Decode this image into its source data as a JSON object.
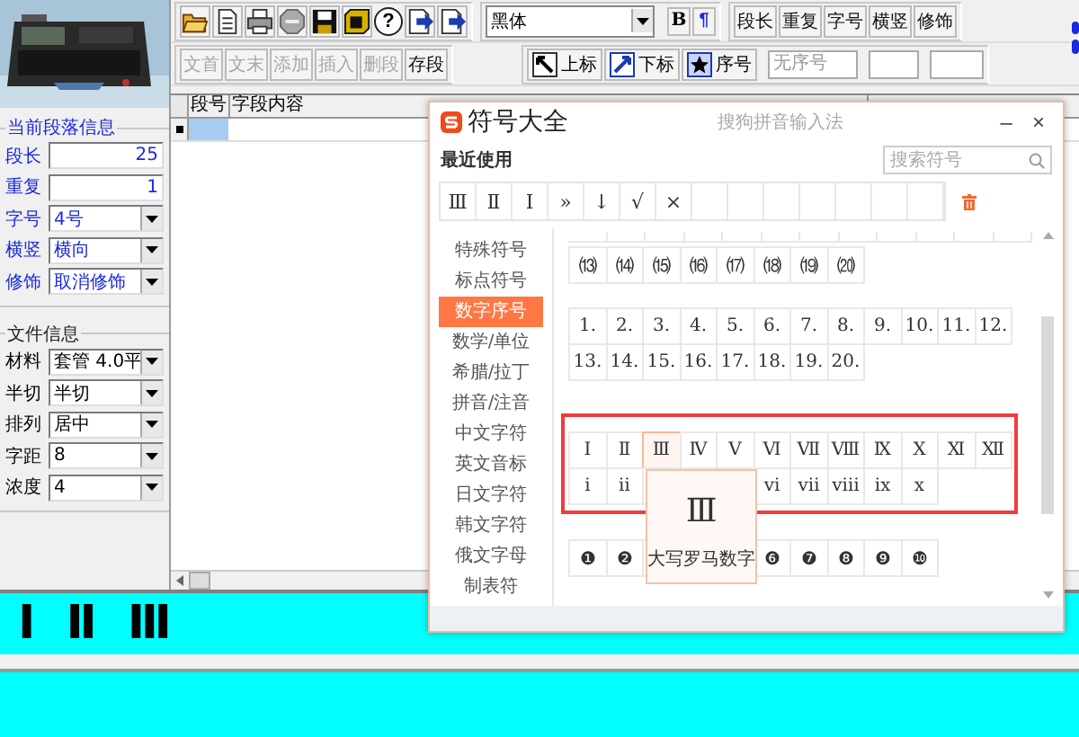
{
  "device_picture": {
    "kind": "picture"
  },
  "paragraph_info": {
    "title": "当前段落信息",
    "fields": [
      {
        "label": "段长",
        "kind": "number",
        "value": "25"
      },
      {
        "label": "重复",
        "kind": "number",
        "value": "1"
      },
      {
        "label": "字号",
        "kind": "select",
        "value": "4号"
      },
      {
        "label": "横竖",
        "kind": "select",
        "value": "横向"
      },
      {
        "label": "修饰",
        "kind": "select",
        "value": "取消修饰"
      }
    ]
  },
  "file_info": {
    "title": "文件信息",
    "fields": [
      {
        "label": "材料",
        "kind": "select",
        "value": "套管 4.0平"
      },
      {
        "label": "半切",
        "kind": "select",
        "value": "半切"
      },
      {
        "label": "排列",
        "kind": "select",
        "value": "居中"
      },
      {
        "label": "字距",
        "kind": "select",
        "value": "8"
      },
      {
        "label": "浓度",
        "kind": "select",
        "value": "4"
      }
    ]
  },
  "toolbar": {
    "icon_buttons": [
      {
        "kind": "folder"
      },
      {
        "kind": "document"
      },
      {
        "kind": "printer"
      },
      {
        "kind": "stop"
      },
      {
        "kind": "floppy"
      },
      {
        "kind": "disk"
      },
      {
        "kind": "help",
        "label": "?"
      },
      {
        "kind": "page-arrow"
      },
      {
        "kind": "page-arrow"
      }
    ],
    "font": "黑体",
    "format_buttons": [
      {
        "kind": "bold",
        "label": "B"
      },
      {
        "kind": "paragraph",
        "label": "¶"
      }
    ],
    "field_buttons": [
      "段长",
      "重复",
      "字号",
      "横竖",
      "修饰"
    ],
    "edit_buttons": [
      {
        "label": "文首",
        "disabled": true
      },
      {
        "label": "文末",
        "disabled": true
      },
      {
        "label": "添加",
        "disabled": true
      },
      {
        "label": "插入",
        "disabled": true
      },
      {
        "label": "删段",
        "disabled": true
      },
      {
        "label": "存段",
        "disabled": false
      }
    ],
    "script_buttons": [
      {
        "kind": "superscript",
        "label": "上标"
      },
      {
        "kind": "subscript",
        "label": "下标"
      },
      {
        "kind": "star",
        "label": "序号"
      }
    ],
    "serial_placeholder": "无序号"
  },
  "table": {
    "columns": [
      "段号",
      "字段内容"
    ],
    "rows": [
      {
        "selected": true
      }
    ]
  },
  "symbol_dialog": {
    "title": "符号大全",
    "subtitle": "搜狗拼音输入法",
    "minimize": "–",
    "close": "×",
    "recent_label": "最近使用",
    "search_placeholder": "搜索符号",
    "recent": [
      "Ⅲ",
      "Ⅱ",
      "Ⅰ",
      "»",
      "↓",
      "√",
      "×"
    ],
    "categories": [
      {
        "label": "特殊符号",
        "selected": false
      },
      {
        "label": "标点符号",
        "selected": false
      },
      {
        "label": "数字序号",
        "selected": true
      },
      {
        "label": "数学/单位",
        "selected": false
      },
      {
        "label": "希腊/拉丁",
        "selected": false
      },
      {
        "label": "拼音/注音",
        "selected": false
      },
      {
        "label": "中文字符",
        "selected": false
      },
      {
        "label": "英文音标",
        "selected": false
      },
      {
        "label": "日文字符",
        "selected": false
      },
      {
        "label": "韩文字符",
        "selected": false
      },
      {
        "label": "俄文字母",
        "selected": false
      },
      {
        "label": "制表符",
        "selected": false
      }
    ],
    "groups": [
      {
        "kind": "plain",
        "rows": [
          [
            {
              "text": "⒀"
            },
            {
              "text": "⒁"
            },
            {
              "text": "⒂"
            },
            {
              "text": "⒃"
            },
            {
              "text": "⒄"
            },
            {
              "text": "⒅"
            },
            {
              "text": "⒆"
            },
            {
              "text": "⒇"
            }
          ]
        ]
      },
      {
        "kind": "plain",
        "rows": [
          [
            {
              "text": "1."
            },
            {
              "text": "2."
            },
            {
              "text": "3."
            },
            {
              "text": "4."
            },
            {
              "text": "5."
            },
            {
              "text": "6."
            },
            {
              "text": "7."
            },
            {
              "text": "8."
            },
            {
              "text": "9."
            },
            {
              "text": "10."
            },
            {
              "text": "11."
            },
            {
              "text": "12."
            }
          ],
          [
            {
              "text": "13."
            },
            {
              "text": "14."
            },
            {
              "text": "15."
            },
            {
              "text": "16."
            },
            {
              "text": "17."
            },
            {
              "text": "18."
            },
            {
              "text": "19."
            },
            {
              "text": "20."
            }
          ]
        ]
      },
      {
        "kind": "framed",
        "rows": [
          [
            {
              "text": "Ⅰ",
              "selected": false
            },
            {
              "text": "Ⅱ",
              "selected": false
            },
            {
              "text": "Ⅲ",
              "selected": true
            },
            {
              "text": "Ⅳ",
              "selected": false
            },
            {
              "text": "Ⅴ",
              "selected": false
            },
            {
              "text": "Ⅵ",
              "selected": false
            },
            {
              "text": "Ⅶ",
              "selected": false
            },
            {
              "text": "Ⅷ",
              "selected": false
            },
            {
              "text": "Ⅸ",
              "selected": false
            },
            {
              "text": "Ⅹ",
              "selected": false
            },
            {
              "text": "Ⅺ",
              "selected": false
            },
            {
              "text": "Ⅻ",
              "selected": false
            }
          ],
          {
            "before_tooltip": [
              {
                "text": "ⅰ"
              },
              {
                "text": "ⅱ"
              }
            ],
            "after_tooltip": [
              {
                "text": "ⅵ"
              },
              {
                "text": "ⅶ"
              },
              {
                "text": "ⅷ"
              },
              {
                "text": "ⅸ"
              },
              {
                "text": "ⅹ"
              }
            ]
          }
        ]
      },
      {
        "kind": "plain",
        "rows": [
          {
            "before_tooltip": [
              {
                "text": "❶"
              },
              {
                "text": "❷"
              }
            ],
            "after_tooltip": [
              {
                "text": "❻"
              },
              {
                "text": "❼"
              },
              {
                "text": "❽"
              },
              {
                "text": "❾"
              },
              {
                "text": "❿"
              }
            ]
          }
        ]
      }
    ],
    "tooltip": {
      "symbol": "Ⅲ",
      "caption": "大写罗马数字"
    }
  },
  "label_preview": [
    "Ⅰ",
    "Ⅱ",
    "Ⅲ"
  ]
}
